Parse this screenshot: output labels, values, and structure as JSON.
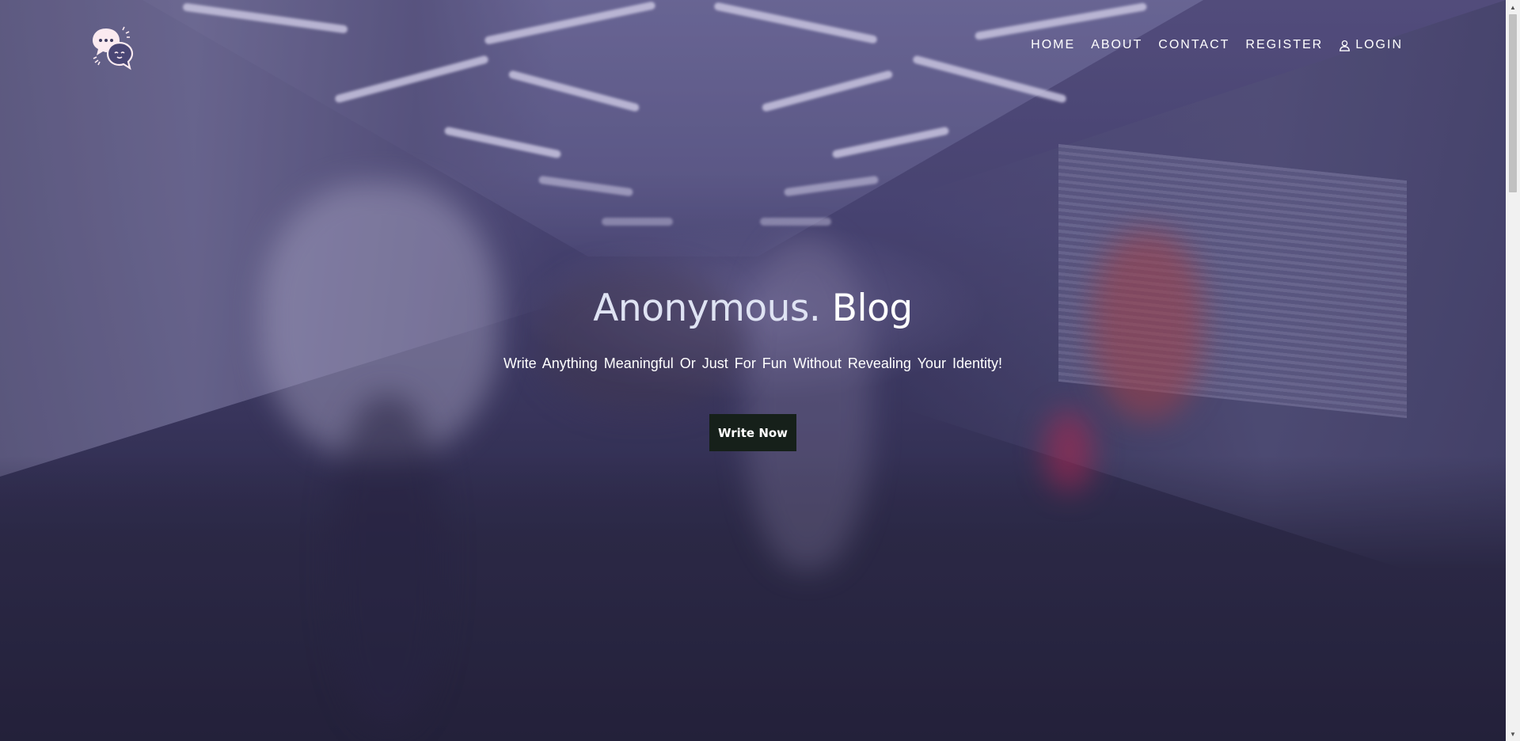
{
  "header": {
    "logo_icon": "chat-bubbles-icon",
    "nav": [
      {
        "label": "HOME",
        "icon": null
      },
      {
        "label": "ABOUT",
        "icon": null
      },
      {
        "label": "CONTACT",
        "icon": null
      },
      {
        "label": "REGISTER",
        "icon": null
      },
      {
        "label": "LOGIN",
        "icon": "user-icon"
      }
    ]
  },
  "hero": {
    "title_brand": "Anonymous.",
    "title_rest": "Blog",
    "subtitle": "Write Anything Meaningful Or Just For Fun Without Revealing Your Identity!",
    "cta_label": "Write Now"
  },
  "colors": {
    "cta_background": "#16201a",
    "text": "#ffffff",
    "overlay": "#4a4675"
  }
}
